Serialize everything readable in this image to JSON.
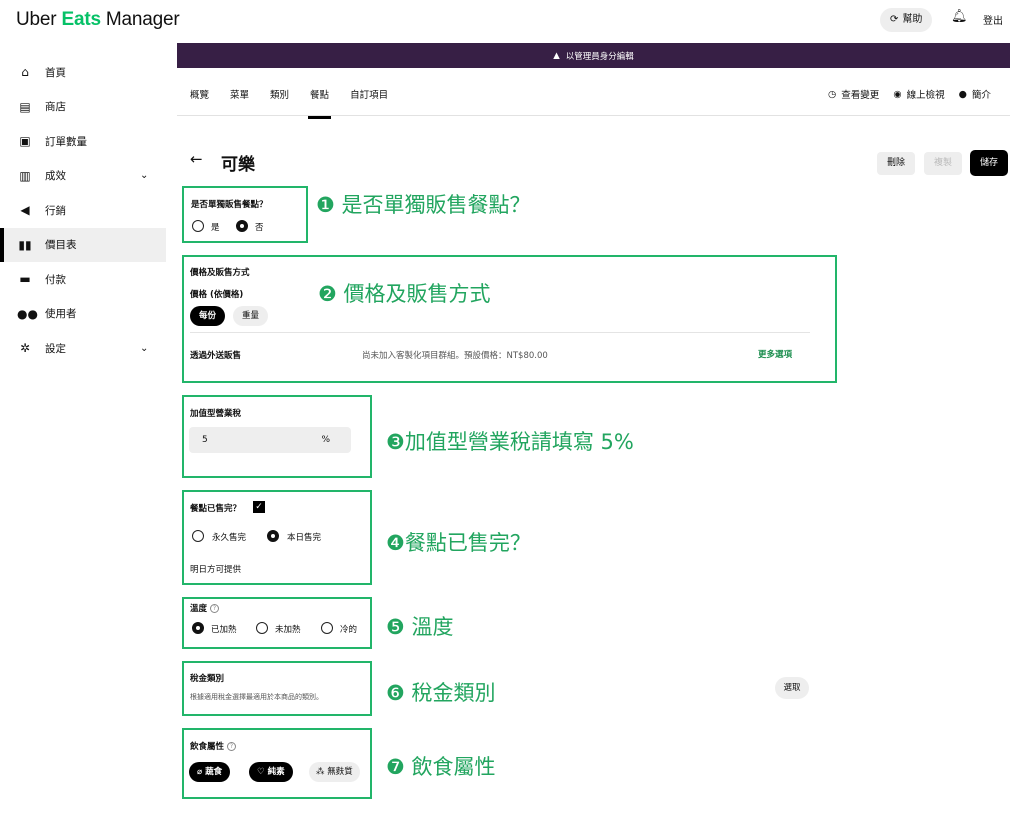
{
  "header": {
    "logo_uber": "Uber",
    "logo_eats": "Eats",
    "logo_manager": "Manager",
    "help_label": "幫助",
    "logout_label": "登出"
  },
  "sidebar": {
    "items": [
      {
        "label": "首頁",
        "icon": "home-icon"
      },
      {
        "label": "商店",
        "icon": "store-icon"
      },
      {
        "label": "訂單數量",
        "icon": "receipt-icon"
      },
      {
        "label": "成效",
        "icon": "chart-icon"
      },
      {
        "label": "行銷",
        "icon": "megaphone-icon"
      },
      {
        "label": "價目表",
        "icon": "menu-book-icon"
      },
      {
        "label": "付款",
        "icon": "wallet-icon"
      },
      {
        "label": "使用者",
        "icon": "users-icon"
      },
      {
        "label": "設定",
        "icon": "gear-icon"
      }
    ]
  },
  "banner": {
    "text": "以管理員身分編輯"
  },
  "tabs": {
    "items": [
      "概覽",
      "菜單",
      "類別",
      "餐點",
      "自訂項目"
    ],
    "active": "餐點",
    "right": [
      "查看變更",
      "線上檢視",
      "簡介"
    ]
  },
  "item": {
    "title": "可樂",
    "delete_label": "刪除",
    "copy_label": "複製",
    "save_label": "儲存"
  },
  "sections": {
    "standalone": {
      "question": "是否單獨販售餐點？",
      "yes": "是",
      "no": "否",
      "selected": "否"
    },
    "pricing": {
      "heading": "價格及販售方式",
      "subheading": "價格 (依價格)",
      "per_item": "每份",
      "by_weight": "重量",
      "third_party": "透過外送販售",
      "third_party_info": "尚未加入客製化項目群組。預設價格：NT$80.00",
      "more_options": "更多選項"
    },
    "tax": {
      "heading": "加值型營業稅",
      "value": "5",
      "unit": "%"
    },
    "sold_out": {
      "heading": "餐點已售完？",
      "checked": true,
      "permanent": "永久售完",
      "today": "本日售完",
      "selected": "本日售完",
      "note": "明日方可提供"
    },
    "temperature": {
      "heading": "溫度",
      "options": [
        "已加熱",
        "未加熱",
        "冷的"
      ],
      "selected": "已加熱"
    },
    "tax_category": {
      "heading": "稅金類別",
      "description": "根據適用稅金選擇最適用於本商品的類別。",
      "choose": "選取"
    },
    "dietary": {
      "heading": "飲食屬性",
      "vegetarian": "蔬食",
      "vegan": "純素",
      "gluten_free": "無麩質"
    }
  },
  "annotations": [
    "❶ 是否單獨販售餐點？",
    "❷ 價格及販售方式",
    "❸加值型營業稅請填寫 5%",
    "❹餐點已售完？",
    "❺ 溫度",
    "❻ 稅金類別",
    "❼ 飲食屬性"
  ],
  "colors": {
    "annotation_green": "#22b56a",
    "banner_purple": "#371f45",
    "link_green": "#1a8d4d"
  }
}
